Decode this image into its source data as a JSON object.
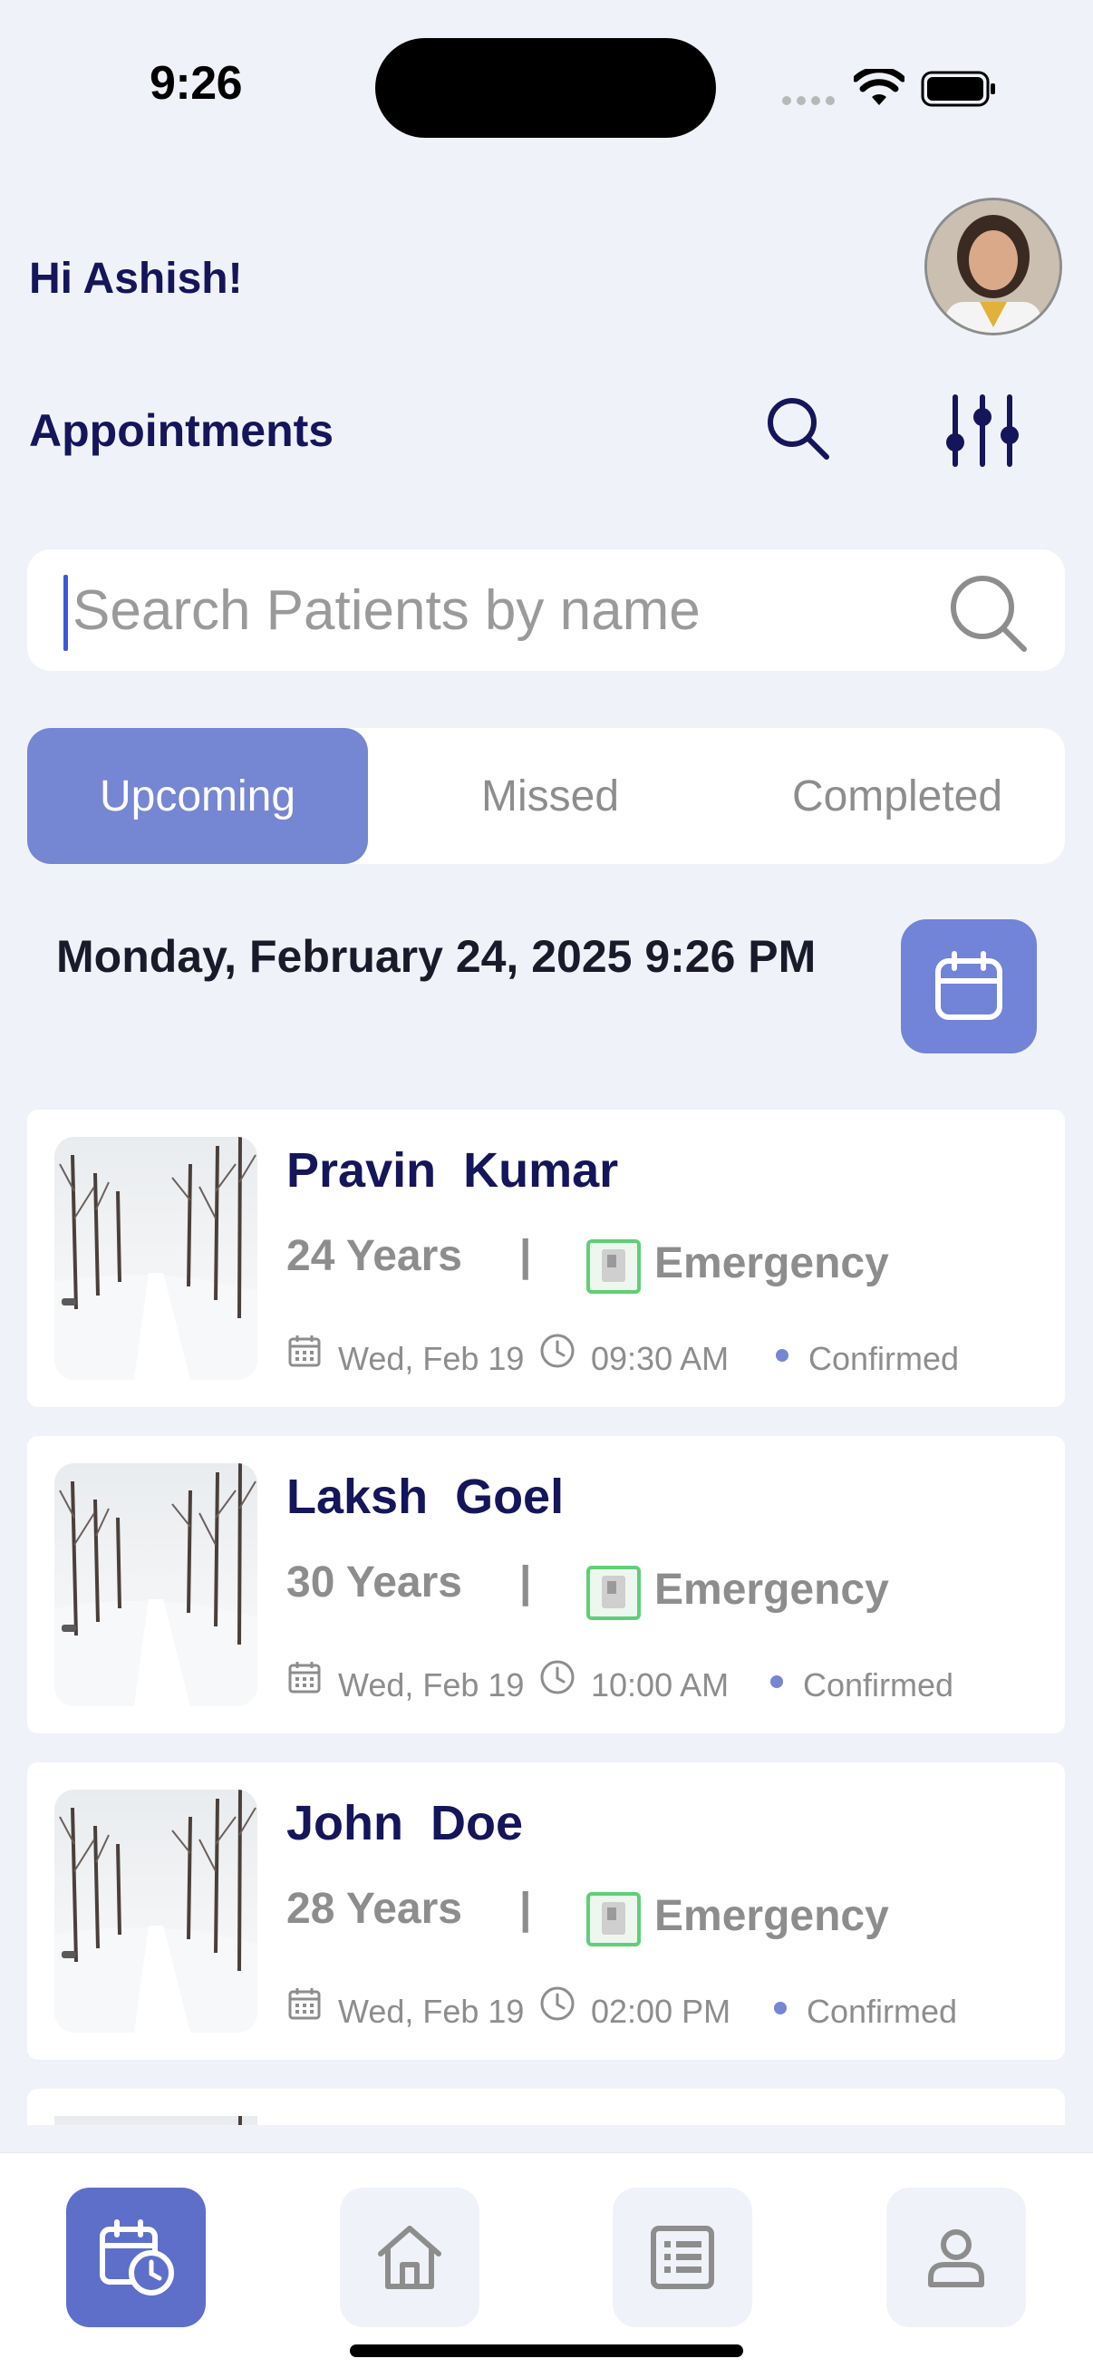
{
  "status_bar": {
    "time": "9:26"
  },
  "header": {
    "greeting": "Hi Ashish!",
    "section_title": "Appointments"
  },
  "search": {
    "placeholder": "Search Patients by name",
    "value": ""
  },
  "tabs": [
    {
      "label": "Upcoming",
      "active": true
    },
    {
      "label": "Missed",
      "active": false
    },
    {
      "label": "Completed",
      "active": false
    }
  ],
  "date_heading": "Monday, February 24, 2025 9:26 PM",
  "appointments": [
    {
      "name": "Pravin  Kumar",
      "age": "24 Years",
      "separator": "|",
      "type": "Emergency",
      "date": "Wed, Feb 19",
      "time": "09:30 AM",
      "status": "Confirmed"
    },
    {
      "name": "Laksh  Goel",
      "age": "30 Years",
      "separator": "|",
      "type": "Emergency",
      "date": "Wed, Feb 19",
      "time": "10:00 AM",
      "status": "Confirmed"
    },
    {
      "name": "John  Doe",
      "age": "28 Years",
      "separator": "|",
      "type": "Emergency",
      "date": "Wed, Feb 19",
      "time": "02:00 PM",
      "status": "Confirmed"
    }
  ],
  "bottom_nav": [
    {
      "icon": "calendar-clock-icon",
      "active": true
    },
    {
      "icon": "home-icon",
      "active": false
    },
    {
      "icon": "list-document-icon",
      "active": false
    },
    {
      "icon": "profile-icon",
      "active": false
    }
  ],
  "colors": {
    "accent": "#7586D3",
    "nav_active": "#5E6FCA",
    "title": "#14155A",
    "background": "#F0F2F9"
  }
}
